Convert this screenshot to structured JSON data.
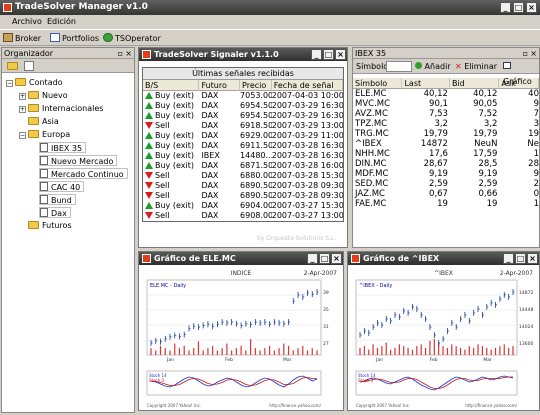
{
  "app": {
    "title": "TradeSolver Manager v1.0"
  },
  "menu": [
    "Archivo",
    "Edición"
  ],
  "toolbar": [
    "Broker",
    "Portfolios",
    "TSOperator"
  ],
  "organizer": {
    "title": "Organizador",
    "tree": [
      {
        "label": "Contado",
        "type": "folder",
        "level": 0,
        "toggle": "-"
      },
      {
        "label": "Nuevo",
        "type": "folder",
        "level": 1,
        "toggle": "+"
      },
      {
        "label": "Internacionales",
        "type": "folder",
        "level": 1,
        "toggle": "+"
      },
      {
        "label": "Asia",
        "type": "folder",
        "level": 1,
        "toggle": ""
      },
      {
        "label": "Europa",
        "type": "folder",
        "level": 1,
        "toggle": "-"
      },
      {
        "label": "IBEX 35",
        "type": "doc",
        "level": 2,
        "toggle": ""
      },
      {
        "label": "Nuevo Mercado",
        "type": "doc",
        "level": 2,
        "toggle": ""
      },
      {
        "label": "Mercado Continuo",
        "type": "doc",
        "level": 2,
        "toggle": ""
      },
      {
        "label": "CAC 40",
        "type": "doc",
        "level": 2,
        "toggle": ""
      },
      {
        "label": "Bund",
        "type": "doc",
        "level": 2,
        "toggle": ""
      },
      {
        "label": "Dax",
        "type": "doc",
        "level": 2,
        "toggle": ""
      },
      {
        "label": "Futuros",
        "type": "folder",
        "level": 1,
        "toggle": ""
      }
    ]
  },
  "signaler": {
    "title": "TradeSolver Signaler v1.1.0",
    "caption": "Últimas señales recibidas",
    "columns": [
      "B/S",
      "Futuro",
      "Precio",
      "Fecha de señal"
    ],
    "rows": [
      {
        "dir": "up",
        "bs": "Buy (exit)",
        "fut": "DAX",
        "price": "7053.00",
        "date": "2007-04-03 10:00:00"
      },
      {
        "dir": "up",
        "bs": "Buy (exit)",
        "fut": "DAX",
        "price": "6954.50",
        "date": "2007-03-29 16:30:00"
      },
      {
        "dir": "up",
        "bs": "Buy (exit)",
        "fut": "DAX",
        "price": "6954.50",
        "date": "2007-03-29 16:30:00"
      },
      {
        "dir": "dn",
        "bs": "Sell",
        "fut": "DAX",
        "price": "6918.50",
        "date": "2007-03-29 13:00:00"
      },
      {
        "dir": "up",
        "bs": "Buy (exit)",
        "fut": "DAX",
        "price": "6929.00",
        "date": "2007-03-29 11:00:00"
      },
      {
        "dir": "up",
        "bs": "Buy (exit)",
        "fut": "DAX",
        "price": "6911.50",
        "date": "2007-03-28 16:30:00"
      },
      {
        "dir": "up",
        "bs": "Buy (exit)",
        "fut": "IBEX",
        "price": "14480...",
        "date": "2007-03-28 16:30:00"
      },
      {
        "dir": "up",
        "bs": "Buy (exit)",
        "fut": "DAX",
        "price": "6871.50",
        "date": "2007-03-28 16:00:00"
      },
      {
        "dir": "dn",
        "bs": "Sell",
        "fut": "DAX",
        "price": "6880.00",
        "date": "2007-03-28 15:30:00"
      },
      {
        "dir": "dn",
        "bs": "Sell",
        "fut": "DAX",
        "price": "6890.50",
        "date": "2007-03-28 09:30:00"
      },
      {
        "dir": "dn",
        "bs": "Sell",
        "fut": "DAX",
        "price": "6890.50",
        "date": "2007-03-28 09:30:00"
      },
      {
        "dir": "up",
        "bs": "Buy (exit)",
        "fut": "DAX",
        "price": "6904.00",
        "date": "2007-03-27 15:30:00"
      },
      {
        "dir": "dn",
        "bs": "Sell",
        "fut": "DAX",
        "price": "6908.00",
        "date": "2007-03-27 13:00:00"
      }
    ],
    "watermark": "by Orquesta Solutions S.L."
  },
  "ibex": {
    "title": "IBEX 35",
    "symbol_label": "Símbolo",
    "add_label": "Añadir",
    "remove_label": "Eliminar",
    "chart_label": "Gráfico",
    "columns": [
      "Símbolo",
      "Last",
      "Bid",
      "Ask"
    ],
    "rows": [
      {
        "sym": "ELE.MC",
        "last": "40,12",
        "bid": "40,12",
        "ask": "40"
      },
      {
        "sym": "MVC.MC",
        "last": "90,1",
        "bid": "90,05",
        "ask": "9"
      },
      {
        "sym": "AVZ.MC",
        "last": "7,53",
        "bid": "7,52",
        "ask": "7"
      },
      {
        "sym": "TPZ.MC",
        "last": "3,2",
        "bid": "3,2",
        "ask": "3"
      },
      {
        "sym": "TRG.MC",
        "last": "19,79",
        "bid": "19,79",
        "ask": "19"
      },
      {
        "sym": "^IBEX",
        "last": "14872",
        "bid": "NeuN",
        "ask": "Ne"
      },
      {
        "sym": "NHH.MC",
        "last": "17,6",
        "bid": "17,59",
        "ask": "1"
      },
      {
        "sym": "DIN.MC",
        "last": "28,67",
        "bid": "28,5",
        "ask": "28"
      },
      {
        "sym": "MDF.MC",
        "last": "9,19",
        "bid": "9,19",
        "ask": "9"
      },
      {
        "sym": "SED.MC",
        "last": "2,59",
        "bid": "2,59",
        "ask": "2"
      },
      {
        "sym": "JAZ.MC",
        "last": "0,67",
        "bid": "0,66",
        "ask": "0"
      },
      {
        "sym": "FAE.MC",
        "last": "19",
        "bid": "19",
        "ask": "1"
      }
    ]
  },
  "chart1": {
    "title": "Gráfico de ELE.MC",
    "header": "INDICE",
    "date": "2-Apr-2007",
    "legend": "ELE.MC - Daily",
    "months": [
      "Jan",
      "Feb",
      "Mar"
    ],
    "bottom_legend": [
      "Stoch 14",
      "Stoch 3"
    ],
    "footer_left": "Copyright 2007 Yahoo! Inc.",
    "footer_right": "http://finance.yahoo.com/",
    "close_series": [
      27,
      27.5,
      27.3,
      28,
      28.5,
      28.8,
      28.6,
      29,
      30.5,
      31,
      30.8,
      31.2,
      31.5,
      31,
      31.5,
      32,
      31.8,
      32,
      31.6,
      31.2,
      31.6,
      31.4,
      32,
      31.8,
      32,
      31.5,
      32,
      31.8,
      31.6,
      32,
      37,
      38.5,
      38,
      39,
      38.7,
      39.2
    ],
    "volume_series": [
      3,
      2,
      4,
      3,
      2,
      5,
      3,
      4,
      2,
      3,
      6,
      2,
      3,
      4,
      2,
      3,
      5,
      2,
      3,
      4,
      2,
      7,
      3,
      2,
      3,
      4,
      2,
      3,
      5,
      4,
      2,
      3,
      4,
      2,
      3,
      2
    ],
    "osc_series": [
      60,
      55,
      45,
      35,
      30,
      40,
      55,
      70,
      80,
      75,
      60,
      45,
      35,
      40,
      55,
      65,
      75,
      70,
      55,
      40,
      30,
      35,
      50,
      65,
      75,
      70,
      55,
      40,
      30,
      45,
      65,
      80,
      85,
      75,
      60,
      70
    ]
  },
  "chart2": {
    "title": "Gráfico de ^IBEX",
    "header": "^IBEX",
    "date": "2-Apr-2007",
    "legend": "^IBEX - Daily",
    "months": [
      "Jan",
      "Feb",
      "Mar"
    ],
    "bottom_legend": [
      "Stoch 14",
      "Stoch 3"
    ],
    "footer_left": "Copyright 2007 Yahoo! Inc.",
    "footer_right": "http://finance.yahoo.com/",
    "close_series": [
      13800,
      13900,
      13850,
      14000,
      14100,
      14050,
      14200,
      14150,
      14300,
      14250,
      14400,
      14350,
      14500,
      14450,
      14300,
      14200,
      14000,
      13800,
      13600,
      13700,
      13900,
      14100,
      14000,
      14200,
      14300,
      14150,
      14350,
      14450,
      14300,
      14500,
      14600,
      14550,
      14700,
      14800,
      14750,
      14872
    ],
    "volume_series": [
      4,
      5,
      3,
      6,
      4,
      5,
      7,
      3,
      4,
      6,
      5,
      4,
      3,
      5,
      6,
      4,
      8,
      9,
      7,
      5,
      4,
      6,
      5,
      4,
      3,
      5,
      4,
      6,
      5,
      4,
      3,
      4,
      5,
      6,
      4,
      5
    ],
    "osc_series": [
      55,
      60,
      70,
      75,
      70,
      60,
      50,
      45,
      55,
      65,
      75,
      80,
      70,
      55,
      40,
      30,
      20,
      15,
      25,
      40,
      55,
      70,
      80,
      75,
      65,
      55,
      60,
      70,
      80,
      75,
      65,
      70,
      80,
      85,
      80,
      75
    ]
  }
}
